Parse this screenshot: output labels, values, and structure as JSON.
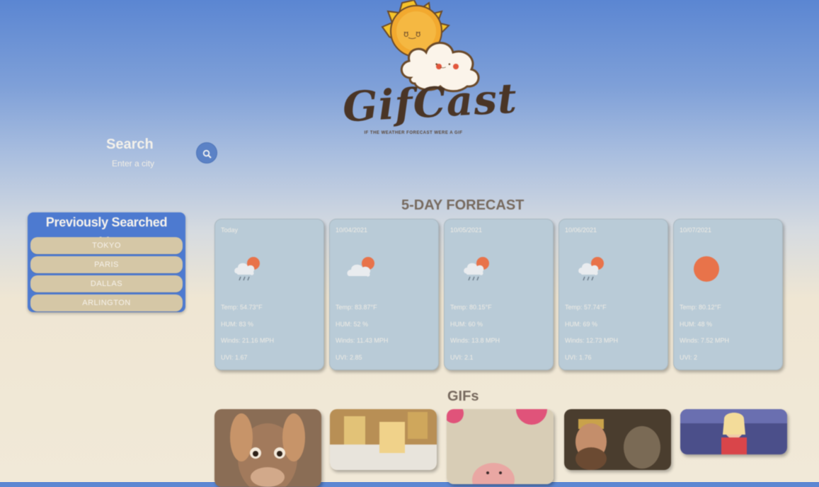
{
  "app": {
    "name": "GifCast",
    "tagline": "IF THE WEATHER FORECAST WERE A GIF"
  },
  "search": {
    "label": "Search",
    "placeholder": "Enter a city",
    "value": "",
    "button_icon": "search-icon"
  },
  "history": {
    "title": "Previously Searched Cities",
    "items": [
      "TOKYO",
      "PARIS",
      "DALLAS",
      "ARLINGTON"
    ]
  },
  "forecast": {
    "title": "5-DAY FORECAST",
    "days": [
      {
        "date": "Today",
        "icon": "rain-sun-icon",
        "temp": "Temp: 54.73°F",
        "hum": "HUM: 83 %",
        "wind": "Winds: 21.16 MPH",
        "uvi": "UVI: 1.67"
      },
      {
        "date": "10/04/2021",
        "icon": "partly-cloudy-icon",
        "temp": "Temp: 83.87°F",
        "hum": "HUM: 52 %",
        "wind": "Winds: 11.43 MPH",
        "uvi": "UVI: 2.85"
      },
      {
        "date": "10/05/2021",
        "icon": "rain-sun-icon",
        "temp": "Temp: 80.15°F",
        "hum": "HUM: 60 %",
        "wind": "Winds: 13.8 MPH",
        "uvi": "UVI: 2.1"
      },
      {
        "date": "10/06/2021",
        "icon": "rain-sun-icon",
        "temp": "Temp: 57.74°F",
        "hum": "HUM: 69 %",
        "wind": "Winds: 12.73 MPH",
        "uvi": "UVI: 1.76"
      },
      {
        "date": "10/07/2021",
        "icon": "sun-icon",
        "temp": "Temp: 80.12°F",
        "hum": "HUM: 48 %",
        "wind": "Winds: 7.52 MPH",
        "uvi": "UVI: 2"
      }
    ]
  },
  "gifs": {
    "title": "GIFs"
  },
  "colors": {
    "accent_blue": "#4d7ad0",
    "card_bg": "#b9cbd7",
    "history_item_bg": "#d5c7a6",
    "sun_orange": "#e8734a"
  }
}
